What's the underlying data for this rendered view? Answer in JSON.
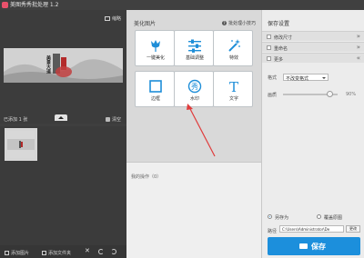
{
  "app": {
    "title": "美图秀秀批处理 1.2"
  },
  "left_panel": {
    "thumbnail_label": "缩略",
    "preview_caption": "美景大道",
    "open_count": "已添加 1 张",
    "clear_label": "清空",
    "bottom": {
      "add_image": "添加图片",
      "add_folder": "添加文件夹"
    }
  },
  "beautify": {
    "title": "美化图片",
    "help_link": "批处理小技巧",
    "tools": [
      {
        "label": "一键美化",
        "icon": "tulip-icon"
      },
      {
        "label": "基础调整",
        "icon": "sliders-icon"
      },
      {
        "label": "特效",
        "icon": "magic-wand-icon"
      },
      {
        "label": "边框",
        "icon": "frame-icon"
      },
      {
        "label": "水印",
        "icon": "watermark-icon"
      },
      {
        "label": "文字",
        "icon": "text-T-icon"
      }
    ],
    "history_label": "我的操作（0）"
  },
  "save_settings": {
    "title": "保存设置",
    "rows": [
      {
        "label": "修改尺寸"
      },
      {
        "label": "重命名"
      },
      {
        "label": "更多"
      }
    ],
    "format_label": "格式",
    "format_value": "不改变格式",
    "quality_label": "画质",
    "quality_value": "90%",
    "quality_level": 0.9,
    "save_as_label": "另存为",
    "overwrite_label": "覆盖原图",
    "path_label": "路径",
    "path_value": "C:\\Users\\Administrator\\De",
    "browse_label": "更改",
    "save_button": "保存"
  },
  "colors": {
    "accent": "#1c8fdc",
    "annotation": "#e03c3c"
  }
}
